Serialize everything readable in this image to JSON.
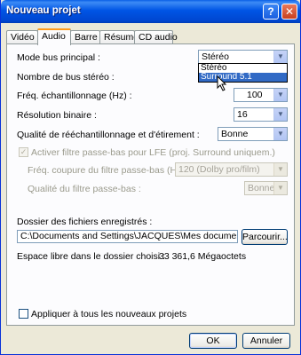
{
  "window": {
    "title": "Nouveau projet"
  },
  "titlebar": {
    "help_glyph": "?",
    "close_glyph": "✕"
  },
  "tabs": [
    "Vidéo",
    "Audio",
    "Barre",
    "Résumé",
    "CD audio"
  ],
  "audio": {
    "mode_bus_label": "Mode bus principal :",
    "mode_bus_value": "Stéréo",
    "mode_bus_options": [
      "Stéréo",
      "Surround 5.1"
    ],
    "bus_stereo_label": "Nombre de bus stéréo :",
    "freq_label": "Fréq. échantillonnage (Hz) :",
    "freq_value": "100",
    "resolution_label": "Résolution binaire :",
    "resolution_value": "16",
    "quality_label": "Qualité de rééchantillonnage et d'étirement :",
    "quality_value": "Bonne",
    "lfe_checkbox_label": "Activer filtre passe-bas pour LFE (proj. Surround uniquem.)",
    "lfe_cutoff_label": "Fréq. coupure du filtre passe-bas (Hz) :",
    "lfe_cutoff_value": "120 (Dolby pro/film)",
    "lfe_quality_label": "Qualité du filtre passe-bas :",
    "lfe_quality_value": "Bonne",
    "folder_label": "Dossier des fichiers enregistrés :",
    "folder_value": "C:\\Documents and Settings\\JACQUES\\Mes documents\\",
    "browse_label": "Parcourir...",
    "free_space_label": "Espace libre dans le dossier choisi :",
    "free_space_value": "33 361,6 Mégaoctets",
    "apply_all_label": "Appliquer à tous les nouveaux projets"
  },
  "buttons": {
    "ok": "OK",
    "cancel": "Annuler"
  },
  "colors": {
    "title_bar": "#0055e5",
    "selection": "#316ac5",
    "tab_highlight": "#ff9a1a"
  }
}
